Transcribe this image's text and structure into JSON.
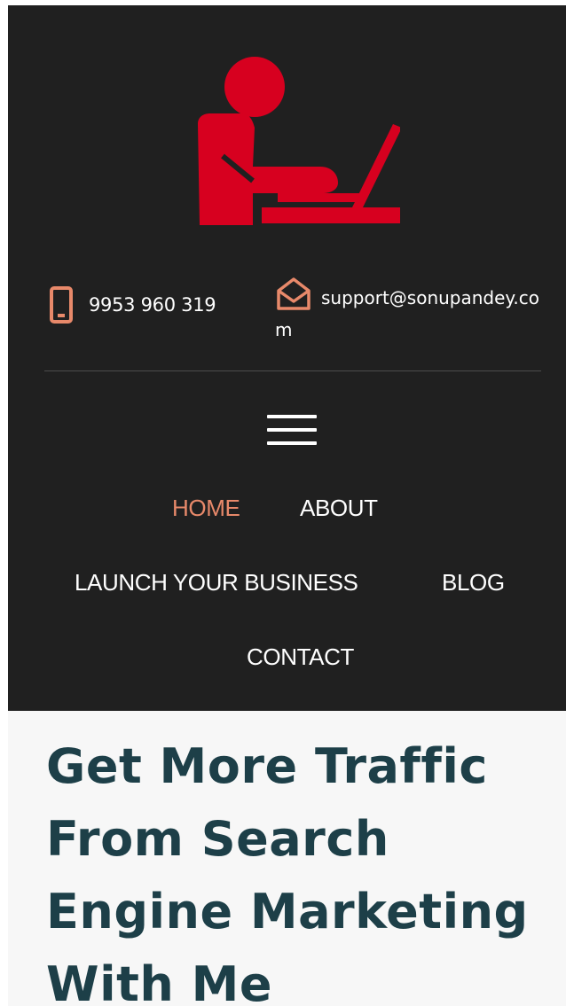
{
  "brand": {
    "logo_icon": "person-at-laptop-icon",
    "logo_color": "#d7001f"
  },
  "contact": {
    "phone_icon": "phone-icon",
    "phone": "9953 960 319",
    "email_icon": "envelope-open-icon",
    "email": "support@sonupandey.com",
    "icon_color": "#e8896a"
  },
  "menu": {
    "toggle_icon": "hamburger-menu-icon",
    "items": [
      {
        "label": "HOME",
        "active": true
      },
      {
        "label": "ABOUT",
        "active": false
      },
      {
        "label": "LAUNCH YOUR BUSINESS",
        "active": false
      },
      {
        "label": "BLOG",
        "active": false
      },
      {
        "label": "CONTACT",
        "active": false
      }
    ]
  },
  "hero": {
    "headline": "Get More Traffic From Search Engine Marketing With Me"
  },
  "colors": {
    "header_bg": "#202020",
    "active_nav": "#e8896a",
    "headline": "#1d3f48",
    "hero_bg": "#f7f7f7"
  }
}
